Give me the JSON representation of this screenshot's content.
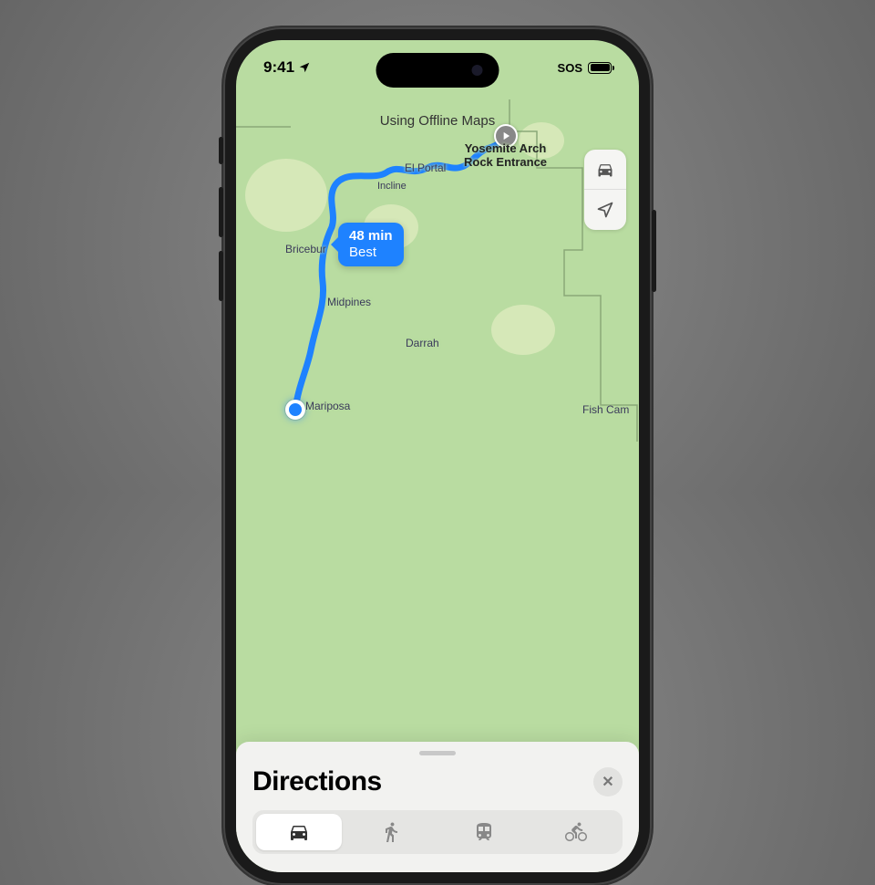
{
  "status": {
    "time": "9:41",
    "sos": "SOS"
  },
  "banner": "Using Offline Maps",
  "destination": {
    "line1": "Yosemite Arch",
    "line2": "Rock Entrance"
  },
  "route": {
    "duration": "48 min",
    "tag": "Best"
  },
  "labels": {
    "el_portal": "El Portal",
    "incline": "Incline",
    "briceburg": "Bricebur",
    "midpines": "Midpines",
    "darrah": "Darrah",
    "mariposa": "Mariposa",
    "fish_camp": "Fish Cam"
  },
  "sheet": {
    "title": "Directions"
  },
  "modes": [
    "drive",
    "walk",
    "transit",
    "bike"
  ]
}
